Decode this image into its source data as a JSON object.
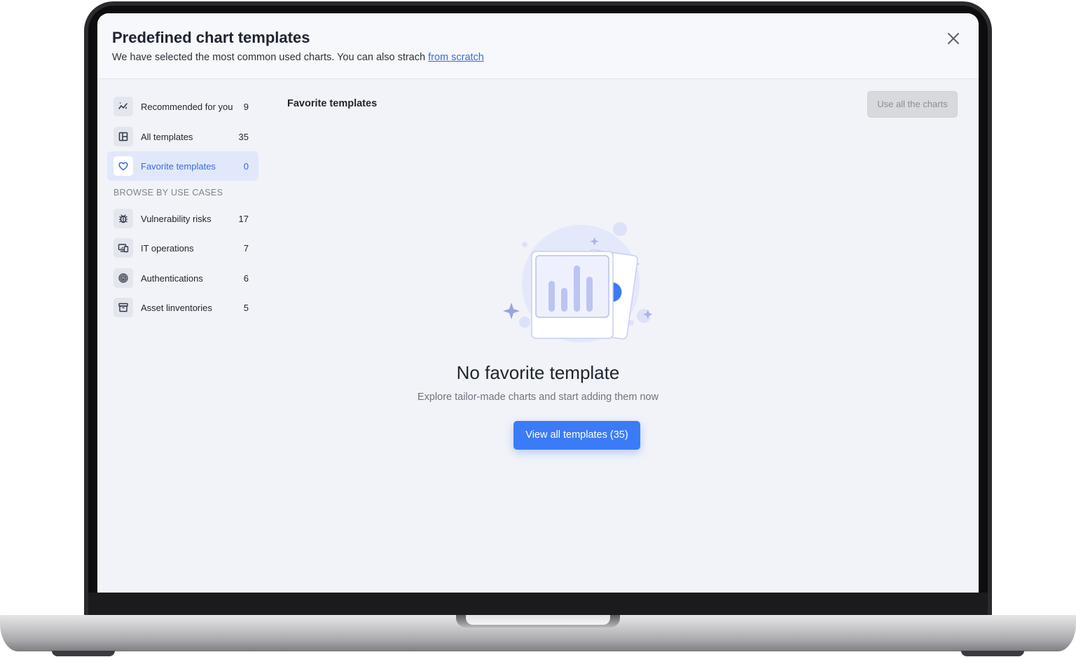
{
  "modal": {
    "title": "Predefined chart templates",
    "subtitle_text": "We have selected the most common used charts. You can also strach ",
    "subtitle_link": "from scratch",
    "close_icon": "close-icon"
  },
  "sidebar": {
    "items": [
      {
        "label": "Recommended for you",
        "count": "9",
        "icon": "sparkle-icon",
        "active": false
      },
      {
        "label": "All templates",
        "count": "35",
        "icon": "layout-icon",
        "active": false
      },
      {
        "label": "Favorite templates",
        "count": "0",
        "icon": "heart-icon",
        "active": true
      }
    ],
    "section_label": "BROWSE BY USE CASES",
    "use_cases": [
      {
        "label": "Vulnerability risks",
        "count": "17",
        "icon": "bug-icon"
      },
      {
        "label": "IT operations",
        "count": "7",
        "icon": "devices-icon"
      },
      {
        "label": "Authentications",
        "count": "6",
        "icon": "fingerprint-icon"
      },
      {
        "label": "Asset linventories",
        "count": "5",
        "icon": "archive-icon"
      }
    ]
  },
  "content": {
    "title": "Favorite templates",
    "use_all_label": "Use all the charts",
    "empty_title": "No favorite template",
    "empty_subtitle": "Explore tailor-made charts and start adding them now",
    "primary_button": "View all templates (35)"
  },
  "colors": {
    "accent": "#3c7bf7",
    "link": "#3a6ad8",
    "active_bg": "#e1e8fb",
    "screen_bg": "#f1f3f8"
  }
}
